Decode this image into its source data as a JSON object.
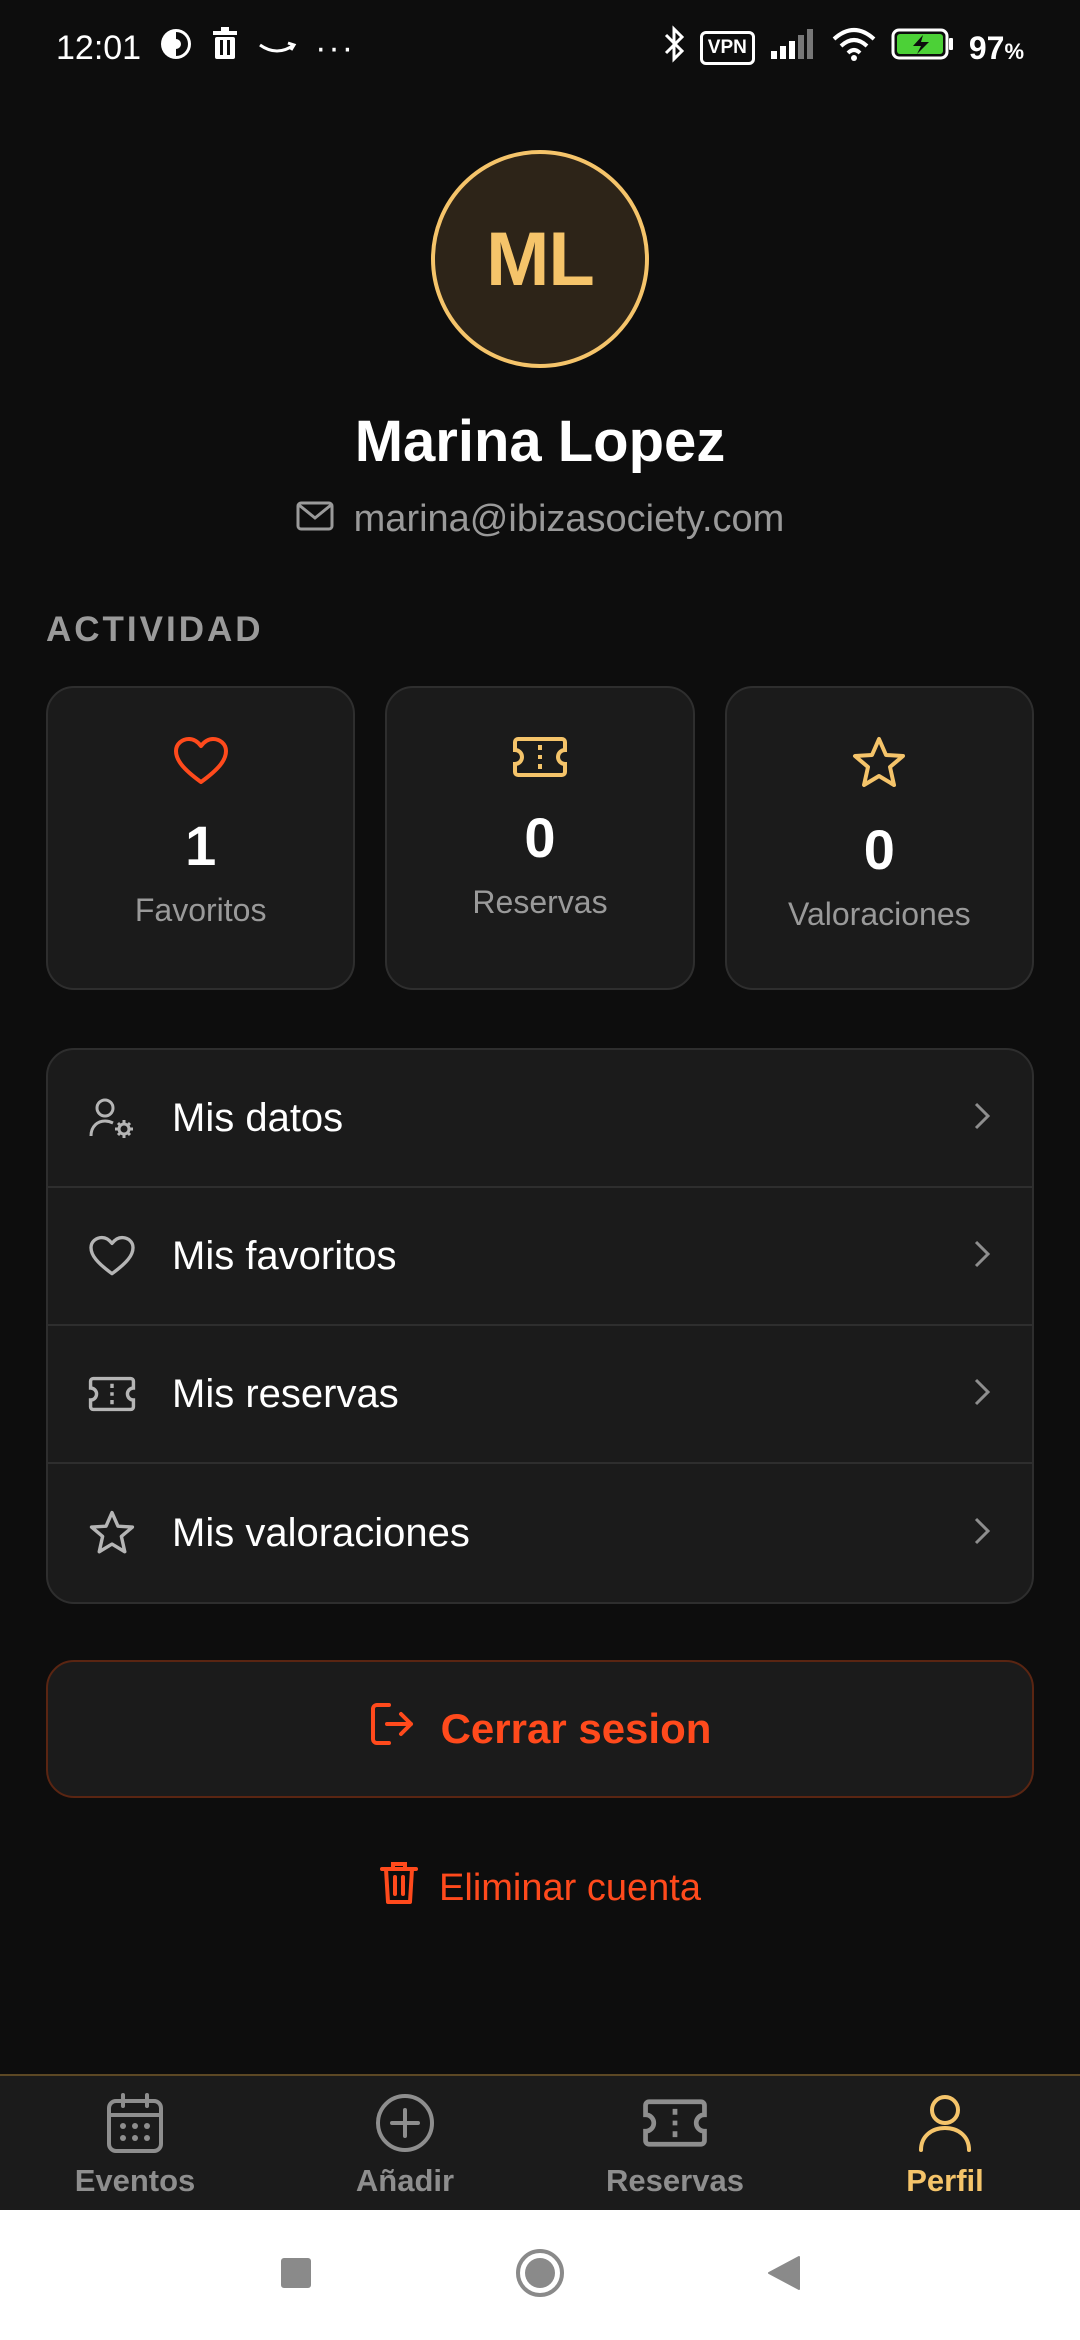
{
  "status_bar": {
    "time": "12:01",
    "vpn_label": "VPN",
    "battery_percent": "97",
    "battery_unit": "%",
    "more": "···"
  },
  "profile": {
    "initials": "ML",
    "name": "Marina Lopez",
    "email": "marina@ibizasociety.com"
  },
  "activity": {
    "label": "ACTIVIDAD",
    "stats": [
      {
        "icon": "heart-icon",
        "value": "1",
        "label": "Favoritos",
        "color": "#ff4a1c"
      },
      {
        "icon": "ticket-icon",
        "value": "0",
        "label": "Reservas",
        "color": "#f5c46a"
      },
      {
        "icon": "star-icon",
        "value": "0",
        "label": "Valoraciones",
        "color": "#f5c46a"
      }
    ]
  },
  "menu": {
    "items": [
      {
        "icon": "user-settings-icon",
        "label": "Mis datos"
      },
      {
        "icon": "heart-icon",
        "label": "Mis favoritos"
      },
      {
        "icon": "ticket-icon",
        "label": "Mis reservas"
      },
      {
        "icon": "star-icon",
        "label": "Mis valoraciones"
      }
    ]
  },
  "actions": {
    "logout_label": "Cerrar sesion",
    "delete_label": "Eliminar cuenta"
  },
  "bottom_nav": {
    "tabs": [
      {
        "icon": "calendar-icon",
        "label": "Eventos",
        "active": false
      },
      {
        "icon": "plus-circle-icon",
        "label": "Añadir",
        "active": false
      },
      {
        "icon": "ticket-icon",
        "label": "Reservas",
        "active": false
      },
      {
        "icon": "user-icon",
        "label": "Perfil",
        "active": true
      }
    ]
  },
  "colors": {
    "accent": "#f5c46a",
    "danger": "#ff4a1c",
    "background": "#0d0d0d",
    "card": "#1b1b1b"
  }
}
